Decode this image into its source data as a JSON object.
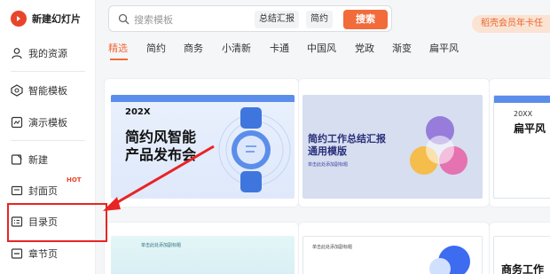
{
  "app": {
    "title": "新建幻灯片"
  },
  "sidebar": {
    "items": [
      {
        "label": "我的资源",
        "icon": "user-icon"
      },
      {
        "label": "智能模板",
        "icon": "smart-template-icon"
      },
      {
        "label": "演示模板",
        "icon": "presentation-template-icon"
      },
      {
        "label": "新建",
        "icon": "new-icon"
      },
      {
        "label": "封面页",
        "icon": "cover-page-icon",
        "badge": "HOT"
      },
      {
        "label": "目录页",
        "icon": "contents-page-icon"
      },
      {
        "label": "章节页",
        "icon": "chapter-page-icon"
      }
    ]
  },
  "search": {
    "placeholder": "搜索模板",
    "tags": [
      "总结汇报",
      "简约"
    ],
    "button_label": "搜索"
  },
  "member_banner": "稻壳会员年卡任",
  "tabs": {
    "items": [
      "精选",
      "简约",
      "商务",
      "小清新",
      "卡通",
      "中国风",
      "党政",
      "渐变",
      "扁平风"
    ],
    "active_index": 0
  },
  "templates": [
    {
      "number": "202X",
      "title_line1": "简约风智能",
      "title_line2": "产品发布会"
    },
    {
      "title_line1": "简约工作总结汇报",
      "title_line2": "通用模版",
      "subtitle": "单击此处添加副标题"
    },
    {
      "number": "20XX",
      "title": "扁平风"
    },
    {
      "text": "单击此处添加副标题"
    },
    {
      "text": "单击此处添加副标题"
    },
    {
      "text": "商务工作"
    }
  ],
  "colors": {
    "accent": "#f26b3a",
    "highlight": "#e82424",
    "brand": "#e8452c"
  }
}
